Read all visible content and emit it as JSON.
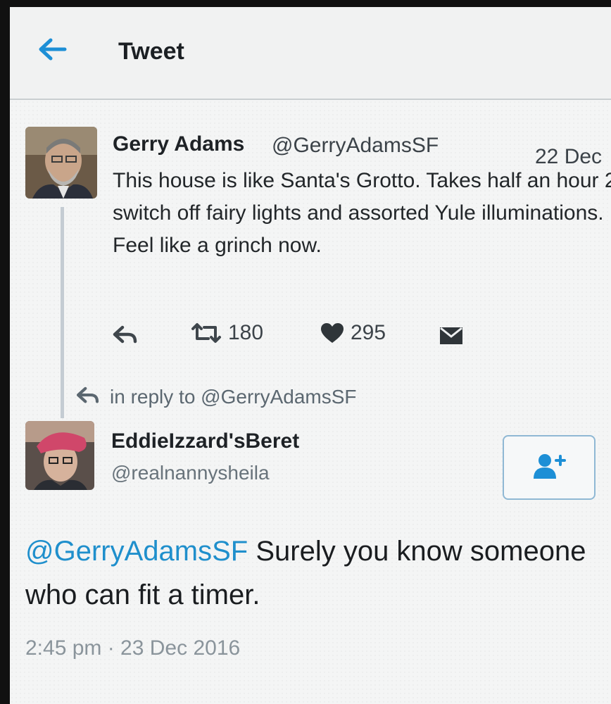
{
  "header": {
    "title": "Tweet",
    "back_icon": "arrow-left-icon",
    "accent_color": "#1da1f2"
  },
  "original_tweet": {
    "author_name": "Gerry Adams",
    "author_handle": "@GerryAdamsSF",
    "date": "22 Dec",
    "text": "This house is like Santa's Grotto. Takes half an hour 2 switch off fairy lights and assorted Yule illuminations. Feel like a grinch now.",
    "actions": {
      "reply_icon": "reply-icon",
      "retweet_icon": "retweet-icon",
      "retweets": "180",
      "like_icon": "heart-icon",
      "likes": "295",
      "message_icon": "envelope-icon"
    }
  },
  "reply_context": {
    "icon": "reply-icon",
    "text": "in reply to @GerryAdamsSF"
  },
  "reply_tweet": {
    "author_name": "EddieIzzard'sBeret",
    "author_handle": "@realnannysheila",
    "follow_icon": "add-user-icon",
    "mention": "@GerryAdamsSF",
    "text": " Surely you know someone who can fit a timer.",
    "timestamp": "2:45 pm · 23 Dec 2016",
    "mention_color": "#1f8fcc"
  }
}
